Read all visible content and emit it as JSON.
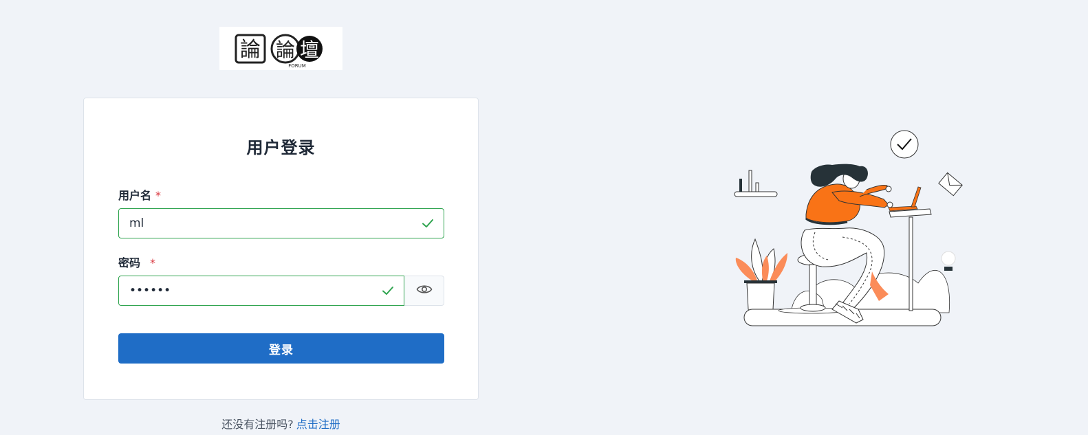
{
  "logo": {
    "chars": [
      "論",
      "論",
      "壇"
    ],
    "caption": "FORUM"
  },
  "login": {
    "title": "用户登录",
    "username_label": "用户名",
    "password_label": "密码",
    "required_mark": "*",
    "username_value": "ml",
    "password_value": "••••••",
    "submit_label": "登录"
  },
  "register": {
    "prompt": "还没有注册吗?",
    "link_label": "点击注册"
  },
  "colors": {
    "primary": "#1f6dc6",
    "success": "#2fa44f",
    "required": "#d9363e",
    "accent_orange": "#f97316",
    "background": "#f0f3f8"
  },
  "icons": {
    "valid": "check-icon",
    "toggle_password": "eye-icon"
  }
}
